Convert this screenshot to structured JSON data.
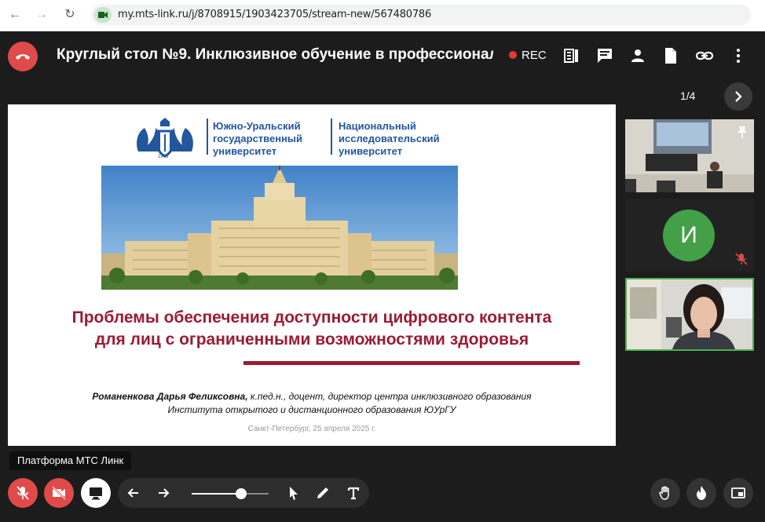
{
  "browser": {
    "url": "my.mts-link.ru/j/8708915/1903423705/stream-new/567480786"
  },
  "meeting": {
    "title": "Круглый стол №9. Инклюзивное обучение в профессионал",
    "rec_label": "REC",
    "slide_counter": "1/4"
  },
  "slide": {
    "logo_left": "Южно-Уральский государственный университет",
    "logo_right": "Национальный исследовательский университет",
    "logo_year": "1943",
    "title_line1": "Проблемы обеспечения доступности цифрового контента",
    "title_line2": "для лиц с ограниченными возможностями здоровья",
    "author_name": "Романенкова Дарья Феликсовна,",
    "author_details_line1": " к.пед.н., доцент, директор центра инклюзивного образования",
    "author_details_line2": "Института открытого и дистанционного образования ЮУрГУ",
    "date": "Санкт-Петербург, 25 апреля 2025 г."
  },
  "participants": {
    "avatar_letter": "И"
  },
  "tooltip": "Платформа МТС Линк",
  "colors": {
    "leave": "#e04a4a",
    "accent_green": "#43a047",
    "slide_title": "#9b1b34",
    "logo_blue": "#22569e"
  }
}
